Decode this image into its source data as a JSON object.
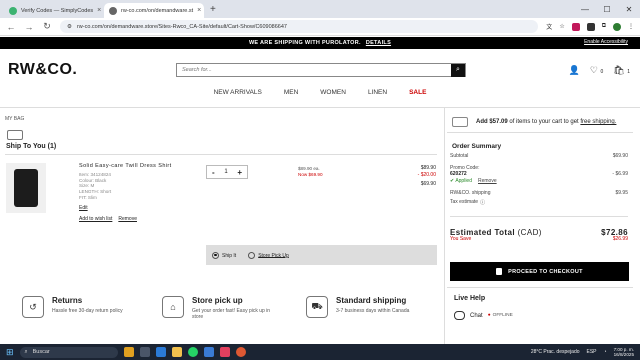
{
  "browser": {
    "tabs": [
      {
        "title": "Verify Codes — SimplyCodes",
        "color": "#3cb371"
      },
      {
        "title": "rw-co.com/on/demandware.st",
        "color": "#666666"
      }
    ],
    "new_tab": "+",
    "url": "rw-co.com/on/demandware.store/Sites-Rwco_CA-Site/default/Cart-Show/C609086647"
  },
  "banner": {
    "text": "WE ARE SHIPPING WITH PUROLATOR.",
    "link": "DETAILS",
    "accessibility": "Enable Accessibility"
  },
  "header": {
    "logo": "RW&CO.",
    "search_placeholder": "Search for...",
    "wishlist_count": "0",
    "cart_count": "1"
  },
  "nav": {
    "items": [
      "NEW ARRIVALS",
      "MEN",
      "WOMEN",
      "LINEN"
    ],
    "sale": "SALE"
  },
  "bag": {
    "breadcrumb": "MY BAG",
    "ship_to": "Ship To You (1)",
    "product": {
      "name": "Solid Easy-care Twill Dress Shirt",
      "item": "Item: 34124824",
      "colour": "Colour: Black",
      "size": "Size: M",
      "length": "LENGTH: Short",
      "fit": "FIT: Slim",
      "edit": "Edit",
      "add_wishlist": "Add to wish list",
      "remove": "Remove",
      "qty": "1",
      "was": "$89.90 ea.",
      "now": "Now $69.90",
      "price": "$89.90",
      "discount": "- $20.00",
      "total": "$69.90"
    },
    "ship_option": "Ship It",
    "pickup_option": "Store Pick Up"
  },
  "services": [
    {
      "title": "Returns",
      "sub": "Hassle free 30-day return policy",
      "icon": "return-icon"
    },
    {
      "title": "Store pick up",
      "sub": "Get your order fast! Easy pick up in store",
      "icon": "store-icon"
    },
    {
      "title": "Standard shipping",
      "sub": "3-7 business days within Canada",
      "icon": "truck-icon"
    }
  ],
  "summary": {
    "promo_amount": "Add $57.09",
    "promo_text": " of items to your cart to get ",
    "promo_link": "free shipping.",
    "title": "Order Summary",
    "subtotal_label": "Subtotal",
    "subtotal": "$69.90",
    "promo_label": "Promo Code:",
    "promo_code": "620272",
    "promo_discount": "- $6.99",
    "applied": "Applied",
    "remove": "Remove",
    "shipping_label": "RW&CO. shipping",
    "shipping": "$9.95",
    "tax_label": "Tax estimate",
    "est_label": "Estimated Total",
    "est_currency": "(CAD)",
    "est_total": "$72.86",
    "save_label": "You Save",
    "save": "$26.99",
    "checkout": "PROCEED TO CHECKOUT",
    "live_help": "Live Help",
    "chat": "Chat",
    "chat_status": "OFFLINE"
  },
  "taskbar": {
    "search": "Buscar",
    "weather": "28°C  Prac. despejado",
    "lang": "ESP",
    "time": "7:00 p. m.",
    "date": "16/8/2025"
  }
}
